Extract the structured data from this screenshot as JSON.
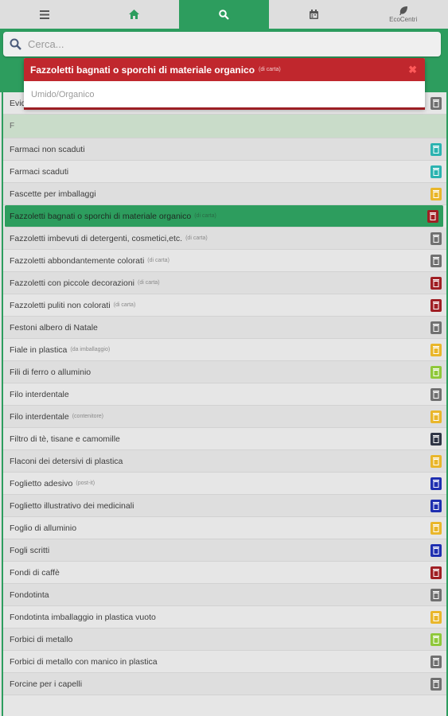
{
  "nav": {
    "tabs": [
      {
        "id": "menu",
        "icon": "menu-icon",
        "label": ""
      },
      {
        "id": "home",
        "icon": "home-icon",
        "label": ""
      },
      {
        "id": "search",
        "icon": "search-icon",
        "label": ""
      },
      {
        "id": "calendar",
        "icon": "calendar-icon",
        "label": ""
      },
      {
        "id": "ecocentri",
        "icon": "leaf-icon",
        "label": "EcoCentri"
      }
    ],
    "active": "search"
  },
  "search": {
    "placeholder": "Cerca..."
  },
  "popup": {
    "title": "Fazzoletti bagnati o sporchi di materiale organico",
    "title_note": "(di carta)",
    "close_icon": "close-icon",
    "category": "Umido/Organico",
    "header_color": "#c0272d"
  },
  "colors": {
    "green": "#2d9d5e",
    "grey": "#707070",
    "red": "#a01f24",
    "yellow": "#e9b62a",
    "teal": "#2bb3b0",
    "blue": "#1f2fb0",
    "navy": "#2f3545",
    "lime": "#8fc83a"
  },
  "list": {
    "partial_first": "Evid",
    "section_letter": "F",
    "items": [
      {
        "name": "Farmaci non scaduti",
        "note": "",
        "bin": "teal"
      },
      {
        "name": "Farmaci scaduti",
        "note": "",
        "bin": "teal"
      },
      {
        "name": "Fascette per imballaggi",
        "note": "",
        "bin": "yellow"
      },
      {
        "name": "Fazzoletti bagnati o sporchi di materiale organico",
        "note": "(di carta)",
        "bin": "red",
        "selected": true
      },
      {
        "name": "Fazzoletti imbevuti di detergenti, cosmetici,etc.",
        "note": "(di carta)",
        "bin": "grey"
      },
      {
        "name": "Fazzoletti abbondantemente colorati",
        "note": "(di carta)",
        "bin": "grey"
      },
      {
        "name": "Fazzoletti con piccole decorazioni",
        "note": "(di carta)",
        "bin": "red"
      },
      {
        "name": "Fazzoletti puliti non colorati",
        "note": "(di carta)",
        "bin": "red"
      },
      {
        "name": "Festoni albero di Natale",
        "note": "",
        "bin": "grey"
      },
      {
        "name": "Fiale in plastica",
        "note": "(da imballaggio)",
        "bin": "yellow"
      },
      {
        "name": "Fili di ferro o alluminio",
        "note": "",
        "bin": "lime"
      },
      {
        "name": "Filo interdentale",
        "note": "",
        "bin": "grey"
      },
      {
        "name": "Filo interdentale",
        "note": "(contenitore)",
        "bin": "yellow"
      },
      {
        "name": "Filtro di tè, tisane e camomille",
        "note": "",
        "bin": "navy"
      },
      {
        "name": "Flaconi dei detersivi di plastica",
        "note": "",
        "bin": "yellow"
      },
      {
        "name": "Foglietto adesivo",
        "note": "(post-it)",
        "bin": "blue"
      },
      {
        "name": "Foglietto illustrativo dei medicinali",
        "note": "",
        "bin": "blue"
      },
      {
        "name": "Foglio di alluminio",
        "note": "",
        "bin": "yellow"
      },
      {
        "name": "Fogli scritti",
        "note": "",
        "bin": "blue"
      },
      {
        "name": "Fondi di caffè",
        "note": "",
        "bin": "red"
      },
      {
        "name": "Fondotinta",
        "note": "",
        "bin": "grey"
      },
      {
        "name": "Fondotinta imballaggio in plastica vuoto",
        "note": "",
        "bin": "yellow"
      },
      {
        "name": "Forbici di metallo",
        "note": "",
        "bin": "lime"
      },
      {
        "name": "Forbici di metallo con manico in plastica",
        "note": "",
        "bin": "grey"
      },
      {
        "name": "Forcine per i capelli",
        "note": "",
        "bin": "grey"
      }
    ]
  }
}
